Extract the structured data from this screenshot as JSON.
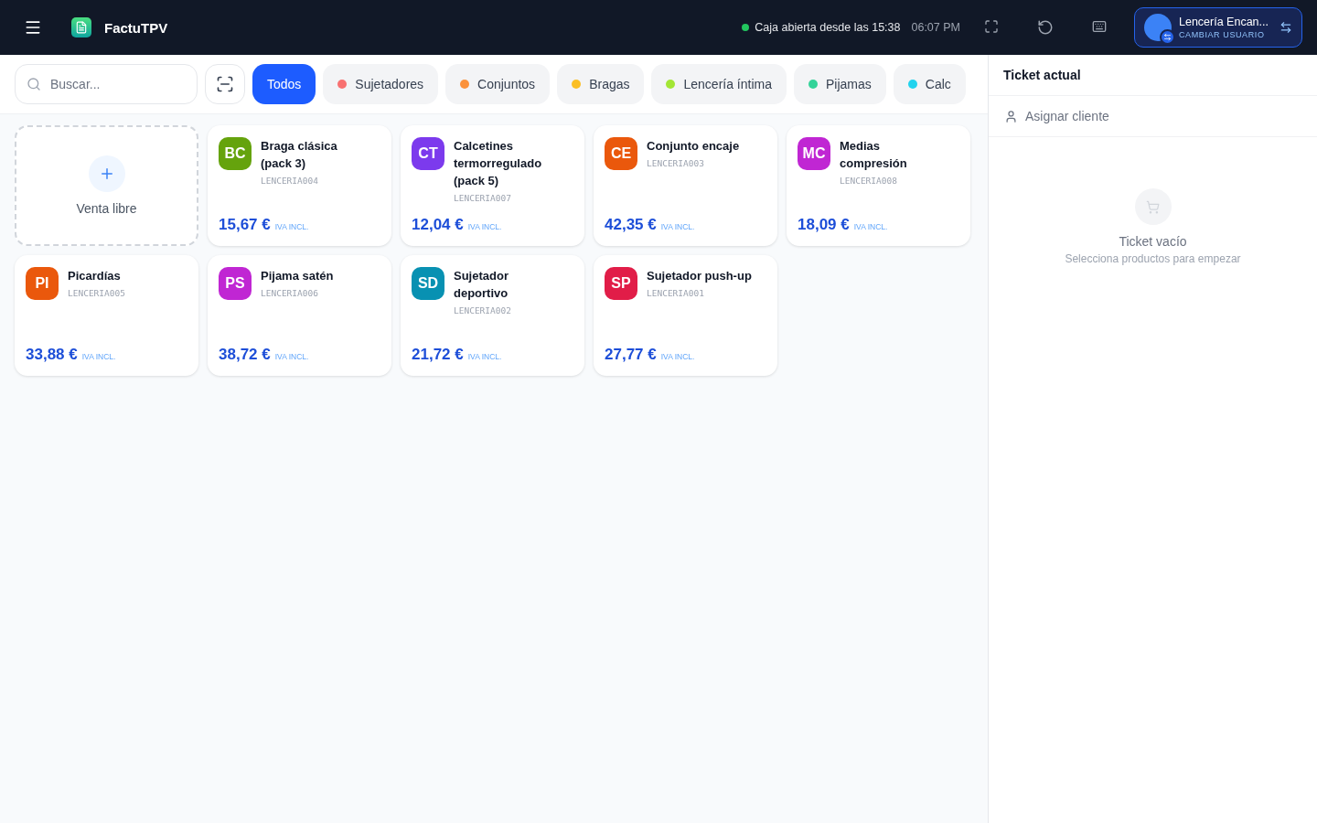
{
  "header": {
    "app_name": "FactuTPV",
    "status": "Caja abierta desde las 15:38",
    "time": "06:07 PM",
    "user": {
      "name": "Lencería Encan...",
      "action": "CAMBIAR USUARIO"
    }
  },
  "search": {
    "placeholder": "Buscar..."
  },
  "categories": [
    {
      "label": "Todos",
      "selected": true
    },
    {
      "label": "Sujetadores",
      "selected": false,
      "color": "#f87171"
    },
    {
      "label": "Conjuntos",
      "selected": false,
      "color": "#fb923c"
    },
    {
      "label": "Bragas",
      "selected": false,
      "color": "#fbbf24"
    },
    {
      "label": "Lencería íntima",
      "selected": false,
      "color": "#a3e635"
    },
    {
      "label": "Pijamas",
      "selected": false,
      "color": "#34d399"
    },
    {
      "label": "Calc",
      "selected": false,
      "color": "#22d3ee"
    }
  ],
  "free_sale": {
    "label": "Venta libre"
  },
  "products": [
    {
      "initials": "BC",
      "name": "Braga clásica (pack 3)",
      "sku": "LENCERIA004",
      "price": "15,67 €",
      "tax": "IVA INCL.",
      "color": "#65a30d"
    },
    {
      "initials": "CT",
      "name": "Calcetines termorregulado (pack 5)",
      "sku": "LENCERIA007",
      "price": "12,04 €",
      "tax": "IVA INCL.",
      "color": "#7c3aed"
    },
    {
      "initials": "CE",
      "name": "Conjunto encaje",
      "sku": "LENCERIA003",
      "price": "42,35 €",
      "tax": "IVA INCL.",
      "color": "#ea580c"
    },
    {
      "initials": "MC",
      "name": "Medias compresión",
      "sku": "LENCERIA008",
      "price": "18,09 €",
      "tax": "IVA INCL.",
      "color": "#c026d3"
    },
    {
      "initials": "PI",
      "name": "Picardías",
      "sku": "LENCERIA005",
      "price": "33,88 €",
      "tax": "IVA INCL.",
      "color": "#ea580c"
    },
    {
      "initials": "PS",
      "name": "Pijama satén",
      "sku": "LENCERIA006",
      "price": "38,72 €",
      "tax": "IVA INCL.",
      "color": "#c026d3"
    },
    {
      "initials": "SD",
      "name": "Sujetador deportivo",
      "sku": "LENCERIA002",
      "price": "21,72 €",
      "tax": "IVA INCL.",
      "color": "#0891b2"
    },
    {
      "initials": "SP",
      "name": "Sujetador push-up",
      "sku": "LENCERIA001",
      "price": "27,77 €",
      "tax": "IVA INCL.",
      "color": "#e11d48"
    }
  ],
  "ticket": {
    "title": "Ticket actual",
    "assign_client": "Asignar cliente",
    "empty_title": "Ticket vacío",
    "empty_hint": "Selecciona productos para empezar"
  }
}
